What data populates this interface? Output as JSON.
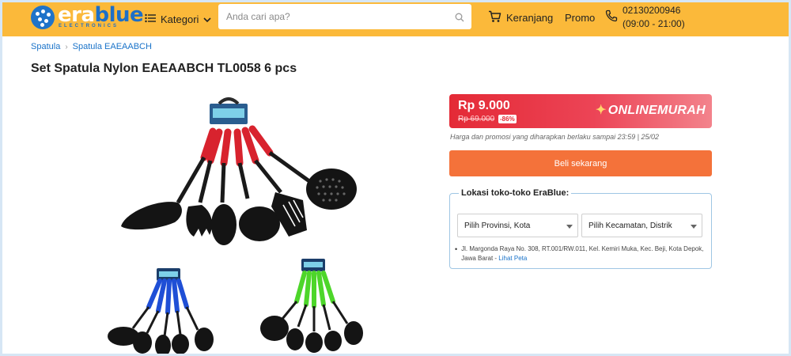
{
  "header": {
    "logo": {
      "name": "erablue",
      "sub": "ELECTRONICS"
    },
    "kategori_label": "Kategori",
    "search": {
      "placeholder": "Anda cari apa?",
      "value": ""
    },
    "cart_label": "Keranjang",
    "promo_label": "Promo",
    "phone": {
      "number": "02130200946",
      "hours": "(09:00 - 21:00)"
    },
    "bg_color": "#fbb93a"
  },
  "breadcrumb": [
    "Spatula",
    "Spatula EAEAABCH"
  ],
  "product": {
    "title": "Set Spatula Nylon EAEAABCH TL0058 6 pcs",
    "images": [
      "red-spatula-set",
      "blue-spatula-set",
      "green-spatula-set"
    ]
  },
  "pricing": {
    "price": "Rp 9.000",
    "old_price": "Rp 69.000",
    "discount": "-86%",
    "promo_tag": "ONLINEMURAH",
    "note": "Harga dan promosi yang diharapkan berlaku sampai 23:59 | 25/02",
    "buy_label": "Beli sekarang",
    "accent": "#f4723a"
  },
  "stores": {
    "title": "Lokasi toko-toko EraBlue:",
    "province_select": "Pilih Provinsi, Kota",
    "district_select": "Pilih Kecamatan, Distrik",
    "address": "Jl. Margonda Raya No. 308, RT.001/RW.011, Kel. Kemiri Muka, Kec. Beji, Kota Depok, Jawa Barat",
    "map_link": "Lihat Peta",
    "map_link_prefix": " - "
  }
}
